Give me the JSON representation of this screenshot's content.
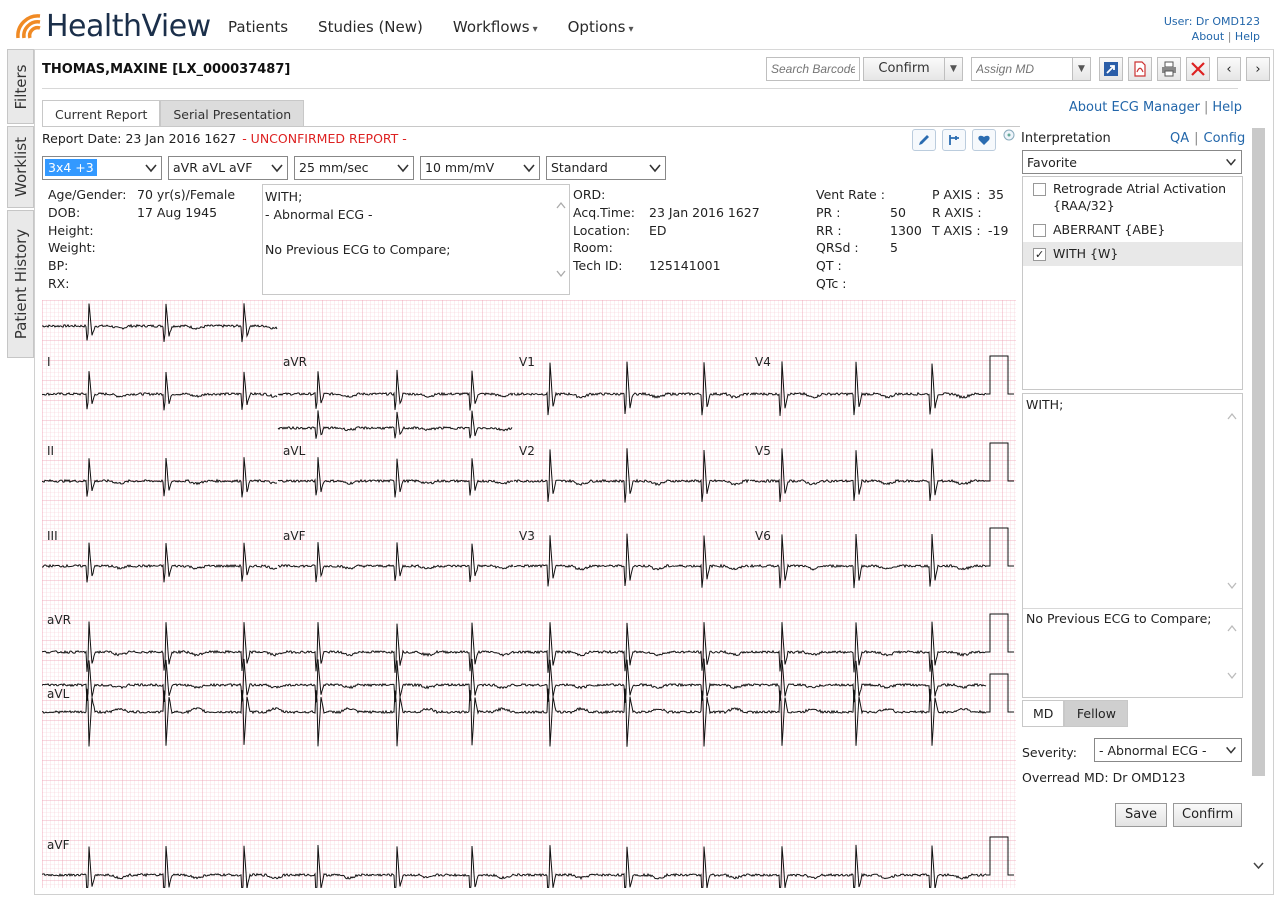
{
  "app": {
    "name": "HealthView"
  },
  "nav": {
    "items": [
      {
        "label": "Patients",
        "caret": false
      },
      {
        "label": "Studies (New)",
        "caret": false
      },
      {
        "label": "Workflows",
        "caret": true
      },
      {
        "label": "Options",
        "caret": true
      }
    ]
  },
  "user": {
    "label": "User: Dr OMD123",
    "about": "About",
    "help": "Help"
  },
  "sidetabs": [
    "Filters",
    "Worklist",
    "Patient History"
  ],
  "patient": {
    "name": "THOMAS,MAXINE [LX_000037487]"
  },
  "toolbar": {
    "barcode_placeholder": "Search Barcode",
    "confirm": "Confirm",
    "assign_placeholder": "Assign MD"
  },
  "tabs": [
    "Current Report",
    "Serial Presentation"
  ],
  "links": {
    "about_ecg": "About ECG Manager",
    "help": "Help"
  },
  "report": {
    "date_label": "Report Date: 23 Jan 2016 1627",
    "status": "- UNCONFIRMED REPORT -"
  },
  "selects": {
    "layout": "3x4 +3",
    "leads": "aVR aVL aVF",
    "speed": "25 mm/sec",
    "gain": "10 mm/mV",
    "filter": "Standard"
  },
  "demographics": {
    "age_gender_label": "Age/Gender:",
    "age_gender": "70 yr(s)/Female",
    "dob_label": "DOB:",
    "dob": "17 Aug 1945",
    "height_label": "Height:",
    "weight_label": "Weight:",
    "bp_label": "BP:",
    "rx_label": "RX:"
  },
  "comment": {
    "line1": "WITH;",
    "line2": "- Abnormal ECG -",
    "line3": "No Previous ECG to Compare;"
  },
  "order": {
    "ord_label": "ORD:",
    "acq_label": "Acq.Time:",
    "acq": "23 Jan 2016 1627",
    "loc_label": "Location:",
    "loc": "ED",
    "room_label": "Room:",
    "tech_label": "Tech ID:",
    "tech": "125141001"
  },
  "measures": {
    "vent_label": "Vent Rate :",
    "pr_label": "PR :",
    "pr": "50",
    "rr_label": "RR :",
    "rr": "1300",
    "qrsd_label": "QRSd :",
    "qrsd": "5",
    "qt_label": "QT :",
    "qtc_label": "QTc :",
    "paxis_label": "P AXIS :",
    "paxis": "35",
    "raxis_label": "R AXIS :",
    "taxis_label": "T AXIS :",
    "taxis": "-19"
  },
  "ecg": {
    "leads_grid": [
      [
        "I",
        "aVR",
        "V1",
        "V4"
      ],
      [
        "II",
        "aVL",
        "V2",
        "V5"
      ],
      [
        "III",
        "aVF",
        "V3",
        "V6"
      ]
    ],
    "rhythm_leads": [
      "aVR",
      "aVL",
      "aVF"
    ]
  },
  "interpretation": {
    "title": "Interpretation",
    "qa": "QA",
    "config": "Config",
    "favorite": "Favorite",
    "items": [
      {
        "label": "Retrograde Atrial Activation {RAA/32}",
        "checked": false
      },
      {
        "label": "ABERRANT {ABE}",
        "checked": false
      },
      {
        "label": "WITH {W}",
        "checked": true
      }
    ],
    "text_top": "WITH;",
    "text_bottom": "No Previous ECG to Compare;",
    "md_tab": "MD",
    "fellow_tab": "Fellow",
    "severity_label": "Severity:",
    "severity": "- Abnormal ECG -",
    "overread": "Overread MD: Dr OMD123",
    "save": "Save",
    "confirm": "Confirm"
  },
  "colors": {
    "accent": "#2266aa",
    "ecg_grid": "#f4b8c6",
    "ecg_grid_major": "#ec8fa6",
    "alert": "#dd2222",
    "logo_orange": "#f08a24"
  }
}
